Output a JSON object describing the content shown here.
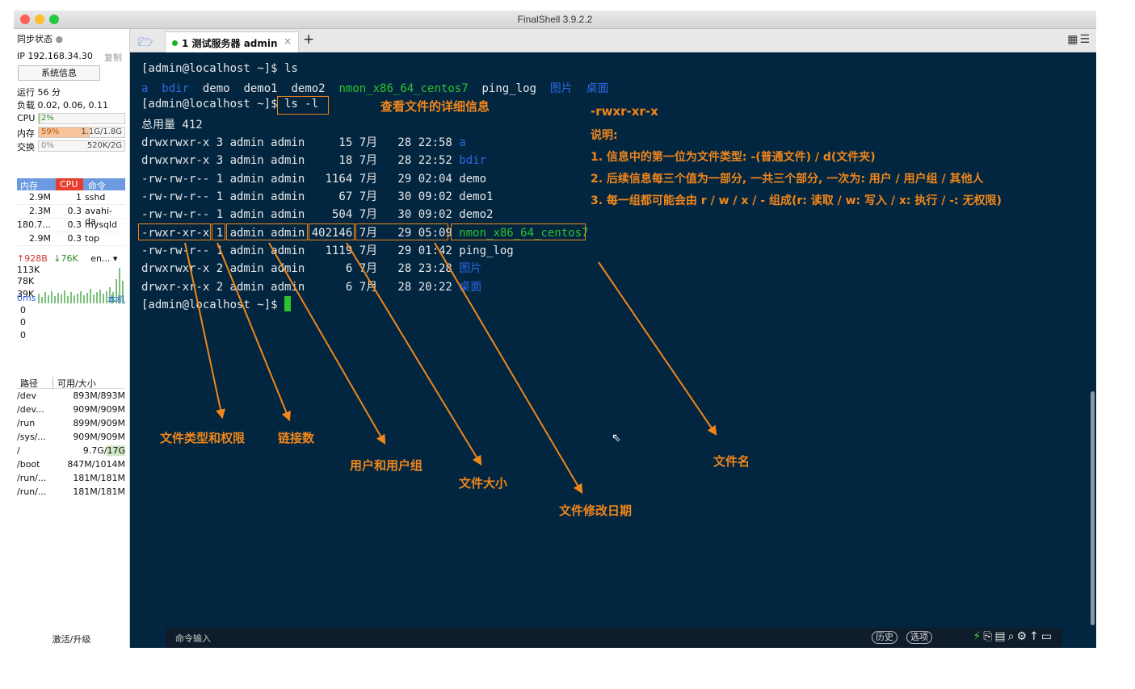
{
  "window": {
    "title": "FinalShell 3.9.2.2"
  },
  "sidebar": {
    "sync_label": "同步状态",
    "ip_label": "IP 192.168.34.30",
    "copy_label": "复制",
    "sysinfo_button": "系统信息",
    "uptime": "运行 56 分",
    "load": "负载 0.02, 0.06, 0.11",
    "cpu_label": "CPU",
    "cpu_value": "2%",
    "cpu_fraction": 0.02,
    "mem_label": "内存",
    "mem_percent": "59%",
    "mem_value": "1.1G/1.8G",
    "mem_fraction": 0.59,
    "swap_label": "交换",
    "swap_percent": "0%",
    "swap_value": "520K/2G",
    "proc_headers": [
      "内存",
      "CPU",
      "命令"
    ],
    "processes": [
      {
        "mem": "2.9M",
        "cpu": "1",
        "cmd": "sshd"
      },
      {
        "mem": "2.3M",
        "cpu": "0.3",
        "cmd": "avahi-da."
      },
      {
        "mem": "180.7...",
        "cpu": "0.3",
        "cmd": "mysqld"
      },
      {
        "mem": "2.9M",
        "cpu": "0.3",
        "cmd": "top"
      }
    ],
    "net_up": "↑928B",
    "net_down": "↓76K",
    "net_iface": "en...",
    "net_scale": [
      "113K",
      "78K",
      "39K"
    ],
    "ping_label": "0ms",
    "ping_host": "本机",
    "ping_values": [
      "0",
      "0",
      "0"
    ],
    "disk_headers": [
      "路径",
      "可用/大小"
    ],
    "disks": [
      {
        "path": "/dev",
        "value": "893M/893M"
      },
      {
        "path": "/dev...",
        "value": "909M/909M"
      },
      {
        "path": "/run",
        "value": "899M/909M"
      },
      {
        "path": "/sys/...",
        "value": "909M/909M"
      },
      {
        "path": "/",
        "value": "9.7G/17G"
      },
      {
        "path": "/boot",
        "value": "847M/1014M"
      },
      {
        "path": "/run/...",
        "value": "181M/181M"
      },
      {
        "path": "/run/...",
        "value": "181M/181M"
      }
    ],
    "upgrade_label": "激活/升级"
  },
  "tabs": [
    {
      "label": "1 测试服务器 admin",
      "close": "×"
    }
  ],
  "tab_add": "+",
  "terminal": {
    "lines": {
      "l1": "[admin@localhost ~]$ ls",
      "l2a": "a",
      "l2b": "bdir",
      "l2c": "demo",
      "l2d": "demo1",
      "l2e": "demo2",
      "l2f": "nmon_x86_64_centos7",
      "l2g": "ping_log",
      "l2h": "图片",
      "l2i": "桌面",
      "l3": "[admin@localhost ~]$ ls -l",
      "l4": "总用量 412",
      "r1": "drwxrwxr-x 3 admin admin     15 7月   28 22:58 ",
      "r1n": "a",
      "r2": "drwxrwxr-x 3 admin admin     18 7月   28 22:52 ",
      "r2n": "bdir",
      "r3": "-rw-rw-r-- 1 admin admin   1164 7月   29 02:04 demo",
      "r4": "-rw-rw-r-- 1 admin admin     67 7月   30 09:02 demo1",
      "r5": "-rw-rw-r-- 1 admin admin    504 7月   30 09:02 demo2",
      "r6": "-rwxr-xr-x 1 admin admin 402146 7月   29 05:09 ",
      "r6n": "nmon_x86_64_centos7",
      "r7": "-rw-rw-r-- 1 admin admin   1119 7月   29 01:42 ping_log",
      "r8": "drwxrwxr-x 2 admin admin      6 7月   28 23:28 ",
      "r8n": "图片",
      "r9": "drwxr-xr-x 2 admin admin      6 7月   28 20:22 ",
      "r9n": "桌面",
      "prompt": "[admin@localhost ~]$ "
    },
    "annotations": {
      "detail": "查看文件的详细信息",
      "perm_example": "-rwxr-xr-x",
      "note_title": "说明:",
      "note1": "1. 信息中的第一位为文件类型: -(普通文件) / d(文件夹)",
      "note2": "2. 后续信息每三个值为一部分, 一共三个部分, 一次为: 用户 / 用户组 / 其他人",
      "note3": "3. 每一组都可能会由 r / w / x / - 组成(r: 读取 / w: 写入 / x: 执行 / -: 无权限)",
      "type_perm": "文件类型和权限",
      "links": "链接数",
      "user_group": "用户和用户组",
      "size": "文件大小",
      "mtime": "文件修改日期",
      "filename": "文件名"
    },
    "command_placeholder": "命令输入",
    "history_button": "历史",
    "options_button": "选项"
  },
  "colors": {
    "terminal_bg": "#032640",
    "annotation": "#f0861a",
    "dir_blue": "#2d66e0",
    "exec_green": "#2ec22e"
  }
}
